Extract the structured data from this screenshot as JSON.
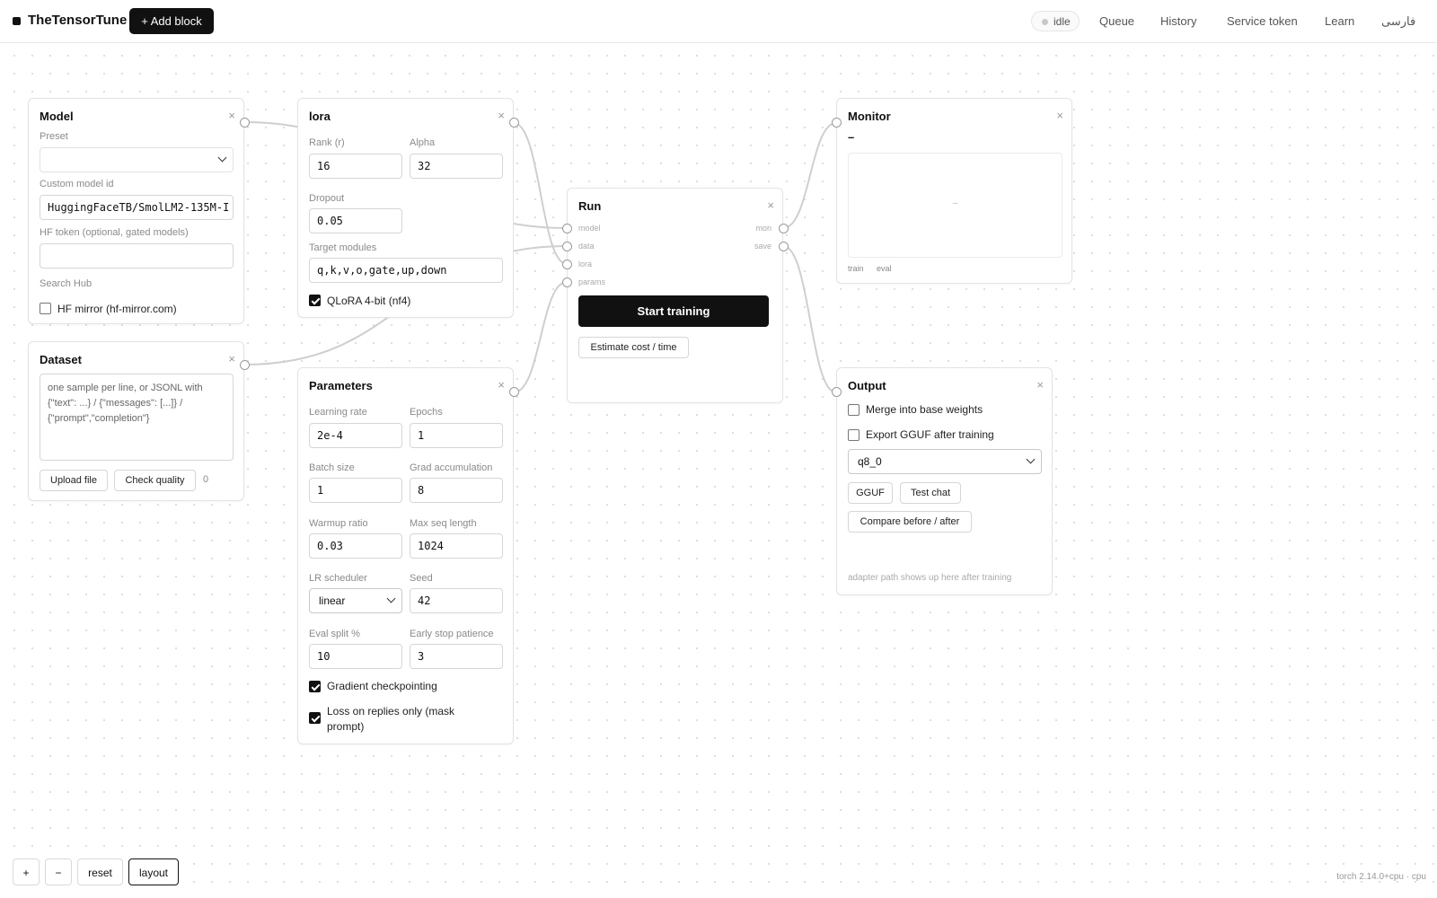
{
  "topbar": {
    "brand": "TheTensorTune",
    "add_block": "+ Add block",
    "status": "idle",
    "nav": [
      "Queue",
      "History",
      "Service token",
      "Learn",
      "فارسی"
    ]
  },
  "model": {
    "title": "Model",
    "close": "×",
    "preset_label": "Preset",
    "preset_value": "",
    "custom_label": "Custom model id",
    "custom_value": "HuggingFaceTB/SmolLM2-135M-I",
    "token_label": "HF token (optional, gated models)",
    "token_value": "",
    "search_label": "Search Hub",
    "mirror_label": "HF mirror (hf-mirror.com)",
    "mirror_checked": false
  },
  "dataset": {
    "title": "Dataset",
    "close": "×",
    "placeholder": "one sample per line, or JSONL with {\"text\": ...} / {\"messages\": [...]} / {\"prompt\",\"completion\"}",
    "upload": "Upload file",
    "check": "Check quality",
    "count": "0"
  },
  "lora": {
    "title": "lora",
    "close": "×",
    "rank_label": "Rank (r)",
    "rank": "16",
    "alpha_label": "Alpha",
    "alpha": "32",
    "dropout_label": "Dropout",
    "dropout": "0.05",
    "target_label": "Target modules",
    "target": "q,k,v,o,gate,up,down",
    "qlora_label": "QLoRA 4-bit (nf4)",
    "qlora_checked": true
  },
  "params": {
    "title": "Parameters",
    "close": "×",
    "lr_label": "Learning rate",
    "lr": "2e-4",
    "epochs_label": "Epochs",
    "epochs": "1",
    "batch_label": "Batch size",
    "batch": "1",
    "grad_label": "Grad accumulation",
    "grad": "8",
    "warmup_label": "Warmup ratio",
    "warmup": "0.03",
    "maxseq_label": "Max seq length",
    "maxseq": "1024",
    "sched_label": "LR scheduler",
    "sched": "linear",
    "seed_label": "Seed",
    "seed": "42",
    "evalsplit_label": "Eval split %",
    "evalsplit": "10",
    "earlystop_label": "Early stop patience",
    "earlystop": "3",
    "gradckpt_label": "Gradient checkpointing",
    "gradckpt_checked": true,
    "loss_label_1": "Loss on replies only (mask",
    "loss_label_2": "prompt)",
    "loss_checked": true
  },
  "run": {
    "title": "Run",
    "close": "×",
    "in_ports": [
      "model",
      "data",
      "lora",
      "params"
    ],
    "out_ports": [
      "mon",
      "save"
    ],
    "start": "Start training",
    "estimate": "Estimate cost / time"
  },
  "monitor": {
    "title": "Monitor",
    "close": "×",
    "value": "–",
    "placeholder": "–",
    "legend_train": "train",
    "legend_eval": "eval"
  },
  "output": {
    "title": "Output",
    "close": "×",
    "merge_label": "Merge into base weights",
    "merge_checked": false,
    "export_label": "Export GGUF after training",
    "export_checked": false,
    "quant": "q8_0",
    "gguf": "GGUF",
    "test_chat": "Test chat",
    "compare": "Compare before / after",
    "note": "adapter path shows up here after training"
  },
  "zoom": {
    "plus": "+",
    "minus": "−",
    "reset": "reset",
    "layout": "layout"
  },
  "footer": "torch 2.14.0+cpu · cpu"
}
